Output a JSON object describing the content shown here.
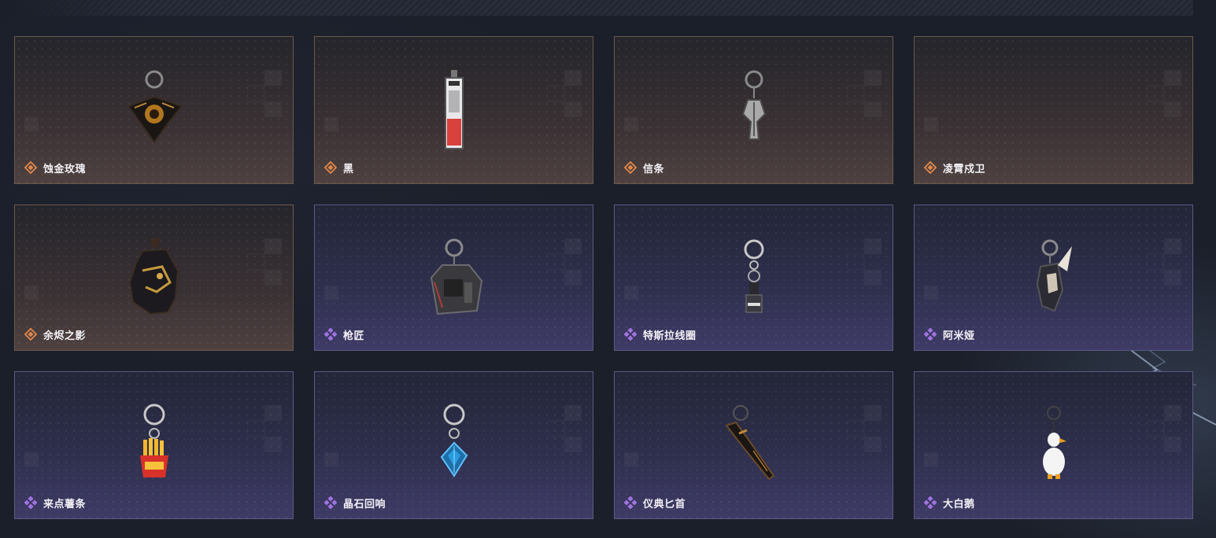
{
  "colors": {
    "orange_rarity": "#e0874a",
    "purple_rarity": "#a073e0"
  },
  "items": [
    {
      "name": "蚀金玫瑰",
      "rarity": "orange",
      "icon": "gold-rose-charm"
    },
    {
      "name": "黑",
      "rarity": "orange",
      "icon": "card-tag-charm"
    },
    {
      "name": "信条",
      "rarity": "orange",
      "icon": "creed-charm"
    },
    {
      "name": "凌霄戍卫",
      "rarity": "orange",
      "icon": "empty-charm"
    },
    {
      "name": "余烬之影",
      "rarity": "orange",
      "icon": "ember-shadow-charm"
    },
    {
      "name": "枪匠",
      "rarity": "purple",
      "icon": "gun-case-charm"
    },
    {
      "name": "特斯拉线圈",
      "rarity": "purple",
      "icon": "tesla-coil-charm"
    },
    {
      "name": "阿米娅",
      "rarity": "purple",
      "icon": "amiya-charm"
    },
    {
      "name": "来点薯条",
      "rarity": "purple",
      "icon": "fries-charm"
    },
    {
      "name": "晶石回响",
      "rarity": "purple",
      "icon": "crystal-charm"
    },
    {
      "name": "仪典匕首",
      "rarity": "purple",
      "icon": "dagger-charm"
    },
    {
      "name": "大白鹅",
      "rarity": "purple",
      "icon": "goose-charm"
    }
  ]
}
